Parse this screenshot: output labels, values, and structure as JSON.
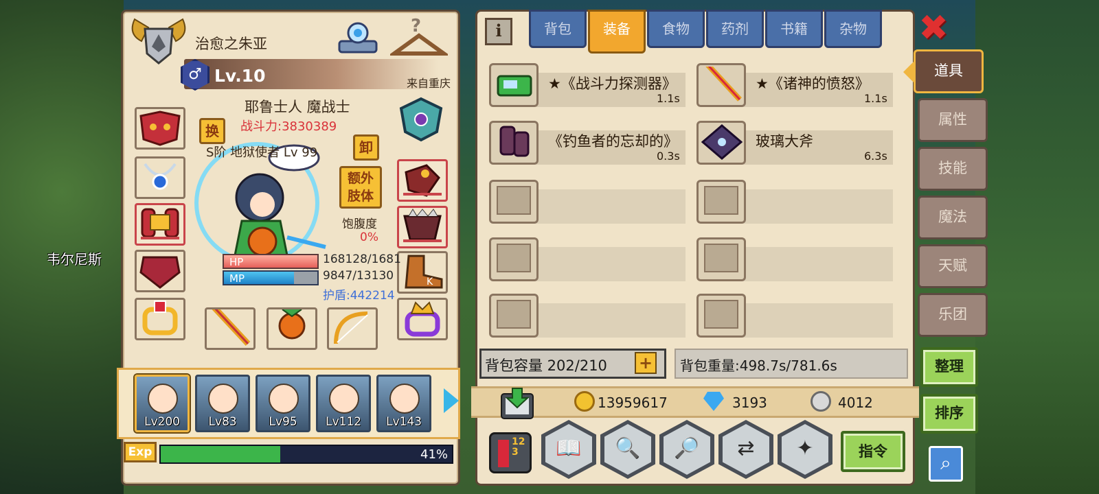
{
  "world": {
    "town_name": "韦尔尼斯"
  },
  "character": {
    "name": "治愈之朱亚",
    "gender_symbol": "♂",
    "level": "Lv.10",
    "origin": "来自重庆",
    "race_class": "耶鲁士人 魔战士",
    "combat_power": "战斗力:3830389",
    "pet_line": "S阶 地狱使者 Lv 99",
    "hunger_label": "饱腹度",
    "hunger_value": "0%",
    "hp_label": "HP",
    "hp_value": "168128/1681",
    "mp_label": "MP",
    "mp_value": "9847/13130",
    "mp_fraction": 0.75,
    "shield": "护盾:442214",
    "buttons": {
      "swap": "换",
      "unequip": "卸",
      "extra_limb": "额外\n肢体"
    }
  },
  "party": [
    {
      "level": "Lv200",
      "selected": true
    },
    {
      "level": "Lv83",
      "selected": false
    },
    {
      "level": "Lv95",
      "selected": false
    },
    {
      "level": "Lv112",
      "selected": false
    },
    {
      "level": "Lv143",
      "selected": false
    }
  ],
  "exp": {
    "label": "Exp",
    "percent_text": "41%",
    "fraction": 0.41
  },
  "inventory": {
    "info_icon": "i",
    "tabs": [
      "背包",
      "装备",
      "食物",
      "药剂",
      "书籍",
      "杂物"
    ],
    "active_tab": "装备",
    "items": [
      {
        "name": "★《战斗力探测器》",
        "time": "1.1s"
      },
      {
        "name": "★《诸神的愤怒》",
        "time": "1.1s"
      },
      {
        "name": "《钓鱼者的忘却的》",
        "time": "0.3s"
      },
      {
        "name": "玻璃大斧",
        "time": "6.3s"
      }
    ],
    "capacity": "背包容量 202/210",
    "weight": "背包重量:498.7s/781.6s",
    "plus_icon": "+"
  },
  "currency": {
    "gold": "13959617",
    "gems": "3193",
    "silver": "4012"
  },
  "bottom_bar": {
    "command": "指令",
    "list_icon": "123"
  },
  "side_tabs": [
    {
      "label": "道具",
      "active": true
    },
    {
      "label": "属性",
      "active": false
    },
    {
      "label": "技能",
      "active": false
    },
    {
      "label": "魔法",
      "active": false
    },
    {
      "label": "天赋",
      "active": false
    },
    {
      "label": "乐团",
      "active": false
    }
  ],
  "side_buttons": {
    "organize": "整理",
    "sort": "排序"
  },
  "colors": {
    "accent": "#f2a72e",
    "panel": "#f0e3c8",
    "tab": "#4a6fa8",
    "danger": "#d9333a",
    "shield": "#3e6fd8"
  }
}
